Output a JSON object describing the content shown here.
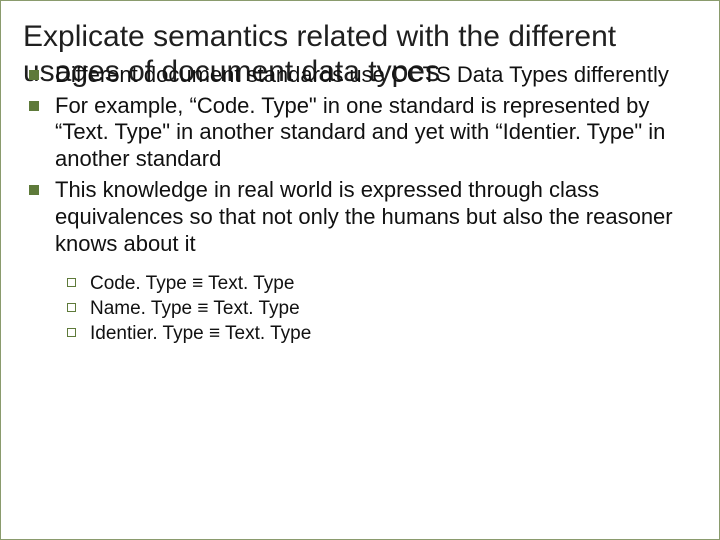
{
  "title": "Explicate semantics related with the different usages of document data types",
  "bullets": [
    "Different document standards use CCTS Data Types differently",
    "For example, “Code. Type\" in one standard is represented by “Text. Type\" in another standard and yet with “Identier. Type\" in another standard",
    "This knowledge in real world is expressed through class equivalences so that not only the humans but also the reasoner knows about it"
  ],
  "subbullets": [
    "Code. Type ≡ Text. Type",
    "Name. Type ≡ Text. Type",
    "Identier. Type ≡ Text. Type"
  ]
}
